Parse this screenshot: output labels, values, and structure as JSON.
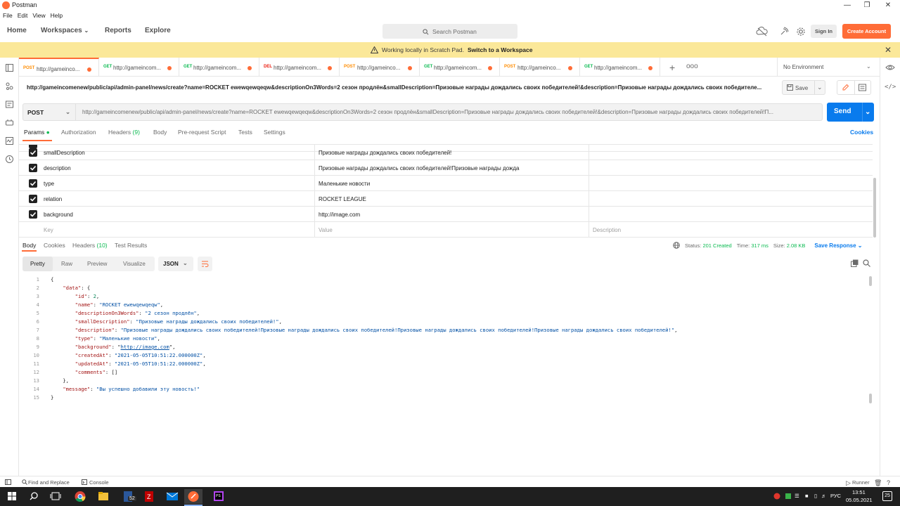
{
  "window": {
    "title": "Postman"
  },
  "menu": [
    "File",
    "Edit",
    "View",
    "Help"
  ],
  "header": {
    "nav": [
      "Home",
      "Workspaces",
      "Reports",
      "Explore"
    ],
    "search_placeholder": "Search Postman",
    "sign_in": "Sign In",
    "create_account": "Create Account"
  },
  "banner": {
    "text": "Working locally in Scratch Pad.",
    "link": "Switch to a Workspace"
  },
  "tabs": [
    {
      "method": "POST",
      "url": "http://gameinco...",
      "unsaved": true
    },
    {
      "method": "GET",
      "url": "http://gameincom...",
      "unsaved": true
    },
    {
      "method": "GET",
      "url": "http://gameincom...",
      "unsaved": true
    },
    {
      "method": "DEL",
      "url": "http://gameincom...",
      "unsaved": true
    },
    {
      "method": "POST",
      "url": "http://gameinco...",
      "unsaved": true
    },
    {
      "method": "GET",
      "url": "http://gameincom...",
      "unsaved": true
    },
    {
      "method": "POST",
      "url": "http://gameinco...",
      "unsaved": true
    },
    {
      "method": "GET",
      "url": "http://gameincom...",
      "unsaved": true
    }
  ],
  "tab_more": "ooo",
  "environment": "No Environment",
  "request": {
    "title": "http://gameincomenew/public/api/admin-panel/news/create?name=ROCKET ewewqewqeqw&descriptionOn3Words=2 сезон продлён&smallDescription=Призовые награды дождались своих победителей!&description=Призовые награды дождались своих победителе...",
    "save": "Save",
    "method": "POST",
    "url": "http://gameincomenew/public/api/admin-panel/news/create?name=ROCKET ewewqewqeqw&descriptionOn3Words=2 сезон продлён&smallDescription=Призовые награды дождались своих победителей!&description=Призовые награды дождались своих победителей!П...",
    "send": "Send"
  },
  "req_tabs": {
    "params": "Params",
    "authorization": "Authorization",
    "headers": "Headers",
    "headers_count": "(9)",
    "body": "Body",
    "prerequest": "Pre-request Script",
    "tests": "Tests",
    "settings": "Settings",
    "cookies": "Cookies"
  },
  "params": [
    {
      "key": "smallDescription",
      "value": "Призовые награды дождались своих победителей!",
      "checked": true
    },
    {
      "key": "description",
      "value": "Призовые награды дождались своих победителей!Призовые награды дожда",
      "checked": true
    },
    {
      "key": "type",
      "value": "Маленькие новости",
      "checked": true
    },
    {
      "key": "relation",
      "value": "ROCKET LEAGUE",
      "checked": true
    },
    {
      "key": "background",
      "value": "http://image.com",
      "checked": true
    }
  ],
  "params_placeholder": {
    "key": "Key",
    "value": "Value",
    "description": "Description"
  },
  "resp_tabs": {
    "body": "Body",
    "cookies": "Cookies",
    "headers": "Headers",
    "headers_count": "(10)",
    "test_results": "Test Results"
  },
  "response_status": {
    "status_label": "Status:",
    "status": "201 Created",
    "time_label": "Time:",
    "time": "317 ms",
    "size_label": "Size:",
    "size": "2.08 KB",
    "save_response": "Save Response"
  },
  "format_tabs": [
    "Pretty",
    "Raw",
    "Preview",
    "Visualize"
  ],
  "format_lang": "JSON",
  "code_lines": [
    "{",
    "    \"data\": {",
    "        \"id\": 2,",
    "        \"name\": \"ROCKET ewewqewqeqw\",",
    "        \"descriptionOn3Words\": \"2 сезон продлён\",",
    "        \"smallDescription\": \"Призовые награды дождались своих победителей!\",",
    "        \"description\": \"Призовые награды дождались своих победителей!Призовые награды дождались своих победителей!Призовые награды дождались своих победителей!Призовые награды дождались своих победителей!\",",
    "        \"type\": \"Маленькие новости\",",
    "        \"background\": \"http://image.com\",",
    "        \"createdAt\": \"2021-05-05T10:51:22.000000Z\",",
    "        \"updatedAt\": \"2021-05-05T10:51:22.000000Z\",",
    "        \"comments\": []",
    "    },",
    "    \"message\": \"Вы успешно добавили эту новость!\"",
    "}"
  ],
  "statusbar": {
    "find_replace": "Find and Replace",
    "console": "Console",
    "runner": "Runner"
  },
  "taskbar": {
    "lang": "РУС",
    "time": "13:51",
    "date": "05.05.2021",
    "badge": "52",
    "notif": "25"
  },
  "colors": {
    "accent": "#ff6c37",
    "send": "#097bed",
    "banner": "#fbe899",
    "get": "#0cbb52",
    "post": "#ff8c00",
    "delete": "#eb2013"
  }
}
